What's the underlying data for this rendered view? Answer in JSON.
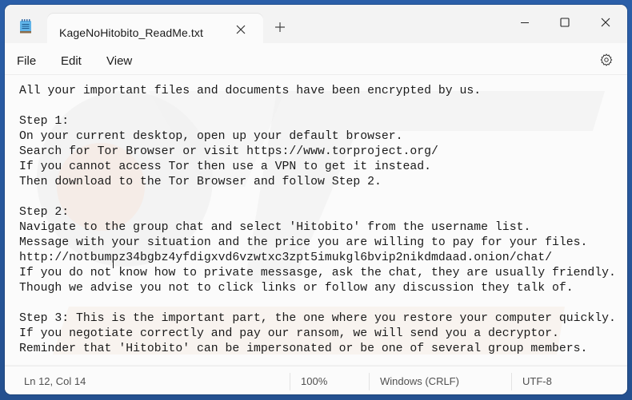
{
  "window": {
    "tab_title": "KageNoHitobito_ReadMe.txt",
    "icons": {
      "app": "notepad-icon",
      "tab_close": "close-icon",
      "new_tab": "plus-icon",
      "minimize": "minimize-icon",
      "maximize": "maximize-icon",
      "close": "close-icon",
      "settings": "gear-icon"
    }
  },
  "menu": {
    "file": "File",
    "edit": "Edit",
    "view": "View"
  },
  "editor": {
    "lines": [
      "All your important files and documents have been encrypted by us.",
      "",
      "Step 1:",
      "On your current desktop, open up your default browser.",
      "Search for Tor Browser or visit https://www.torproject.org/",
      "If you cannot access Tor then use a VPN to get it instead.",
      "Then download to the Tor Browser and follow Step 2.",
      "",
      "Step 2:",
      "Navigate to the group chat and select 'Hitobito' from the username list.",
      "Message with your situation and the price you are willing to pay for your files.",
      "http://notbumpz34bgbz4yfdigxvd6vzwtxc3zpt5imukgl6bvip2nikdmdaad.onion/chat/",
      "If you do not know how to private messasge, ask the chat, they are usually friendly.",
      "Though we advise you not to click links or follow any discussion they talk of.",
      "",
      "Step 3: This is the important part, the one where you restore your computer quickly.",
      "If you negotiate correctly and pay our ransom, we will send you a decryptor.",
      "Reminder that 'Hitobito' can be impersonated or be one of several group members."
    ]
  },
  "status": {
    "position": "Ln 12, Col 14",
    "zoom": "100%",
    "line_ending": "Windows (CRLF)",
    "encoding": "UTF-8"
  },
  "colors": {
    "desktop": "#2a5ea8",
    "titlebar": "#f3f3f3",
    "editor_bg": "#fbfbfb",
    "text": "#1a1a1a",
    "status_text": "#505050"
  }
}
